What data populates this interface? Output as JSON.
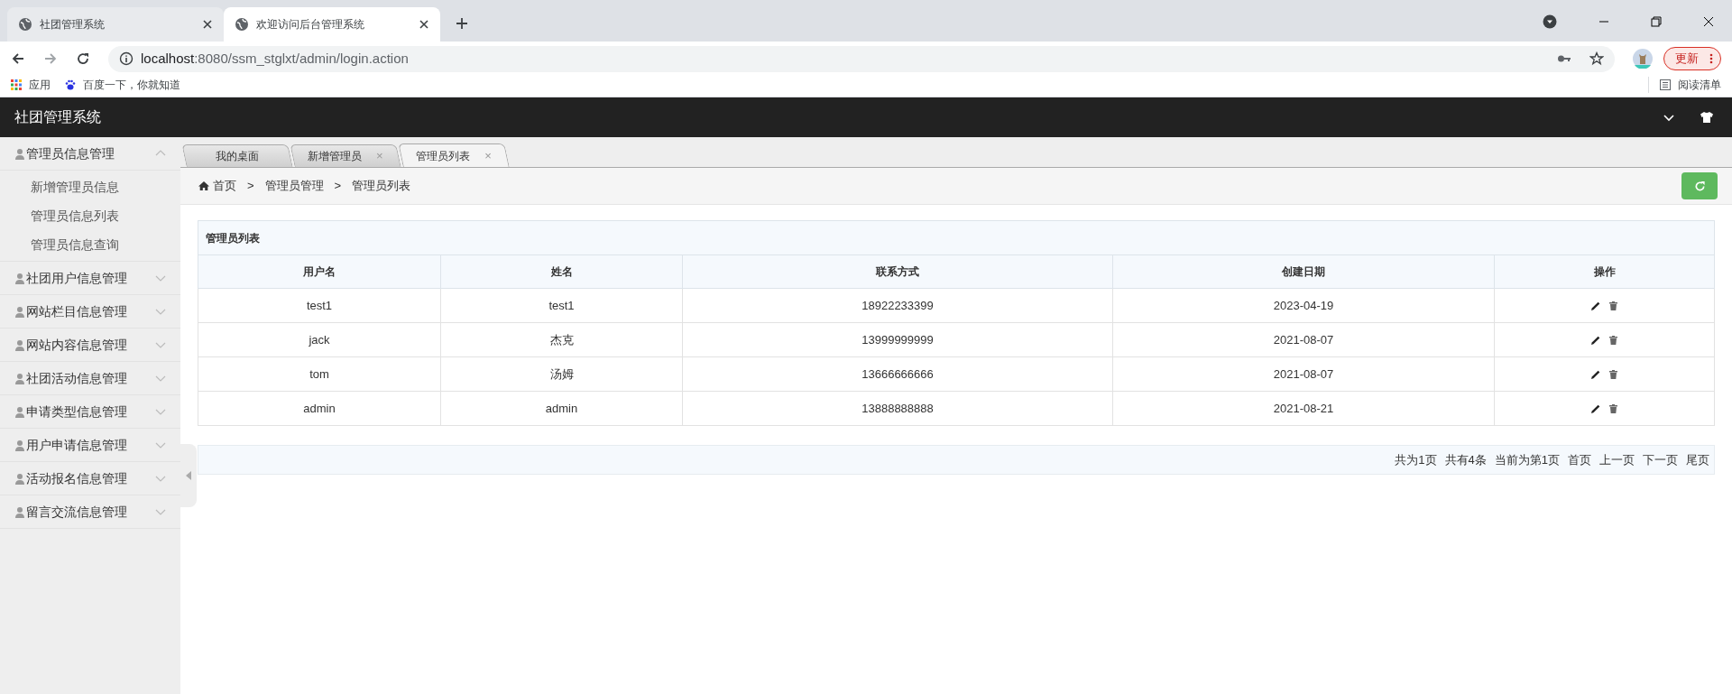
{
  "browser": {
    "tabs": [
      {
        "title": "社团管理系统",
        "selected": false
      },
      {
        "title": "欢迎访问后台管理系统",
        "selected": true
      }
    ],
    "address": {
      "host": "localhost",
      "rest": ":8080/ssm_stglxt/admin/login.action"
    },
    "update_button": "更新",
    "bookmarks": [
      "应用",
      "百度一下，你就知道"
    ],
    "reading_list": "阅读清单"
  },
  "app": {
    "title": "社团管理系统"
  },
  "sidebar": {
    "groups": [
      {
        "label": "管理员信息管理",
        "expanded": true,
        "children": [
          {
            "label": "新增管理员信息"
          },
          {
            "label": "管理员信息列表"
          },
          {
            "label": "管理员信息查询"
          }
        ]
      },
      {
        "label": "社团用户信息管理",
        "expanded": false
      },
      {
        "label": "网站栏目信息管理",
        "expanded": false
      },
      {
        "label": "网站内容信息管理",
        "expanded": false
      },
      {
        "label": "社团活动信息管理",
        "expanded": false
      },
      {
        "label": "申请类型信息管理",
        "expanded": false
      },
      {
        "label": "用户申请信息管理",
        "expanded": false
      },
      {
        "label": "活动报名信息管理",
        "expanded": false
      },
      {
        "label": "留言交流信息管理",
        "expanded": false
      }
    ]
  },
  "page_tabs": [
    {
      "label": "我的桌面",
      "selected": false,
      "closable": false
    },
    {
      "label": "新增管理员",
      "selected": false,
      "closable": true
    },
    {
      "label": "管理员列表",
      "selected": true,
      "closable": true
    }
  ],
  "close_glyph": "×",
  "breadcrumb": [
    "首页",
    "管理员管理",
    "管理员列表"
  ],
  "breadcrumb_separator": ">",
  "table": {
    "caption": "管理员列表",
    "columns": [
      "用户名",
      "姓名",
      "联系方式",
      "创建日期",
      "操作"
    ],
    "rows": [
      [
        "test1",
        "test1",
        "18922233399",
        "2023-04-19"
      ],
      [
        "jack",
        "杰克",
        "13999999999",
        "2021-08-07"
      ],
      [
        "tom",
        "汤姆",
        "13666666666",
        "2021-08-07"
      ],
      [
        "admin",
        "admin",
        "13888888888",
        "2021-08-21"
      ]
    ]
  },
  "pagination": [
    "共为1页",
    "共有4条",
    "当前为第1页",
    "首页",
    "上一页",
    "下一页",
    "尾页"
  ]
}
